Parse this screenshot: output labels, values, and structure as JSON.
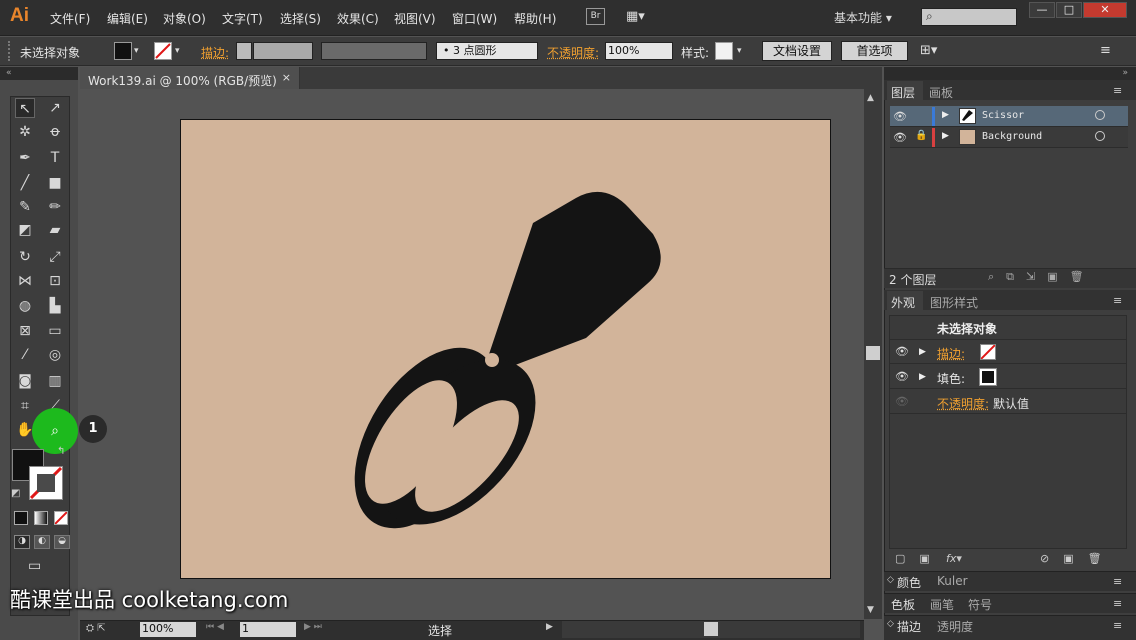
{
  "app": {
    "logo": "Ai"
  },
  "menu": [
    "文件(F)",
    "编辑(E)",
    "对象(O)",
    "文字(T)",
    "选择(S)",
    "效果(C)",
    "视图(V)",
    "窗口(W)",
    "帮助(H)"
  ],
  "bridge_label": "Br",
  "workspace": "基本功能",
  "window_buttons": [
    "—",
    "□",
    "✕"
  ],
  "control": {
    "selection": "未选择对象",
    "stroke_label": "描边:",
    "brush": "3 点圆形",
    "opacity_label": "不透明度:",
    "opacity_value": "100%",
    "style_label": "样式:",
    "doc_setup": "文档设置",
    "preferences": "首选项"
  },
  "document": {
    "tab_title": "Work139.ai @ 100% (RGB/预览)",
    "close": "×"
  },
  "layers": {
    "tabs": [
      "图层",
      "画板"
    ],
    "items": [
      {
        "name": "Scissor"
      },
      {
        "name": "Background"
      }
    ],
    "count": "2 个图层"
  },
  "appearance": {
    "tabs": [
      "外观",
      "图形样式"
    ],
    "title": "未选择对象",
    "stroke_label": "描边:",
    "fill_label": "填色:",
    "opacity_label": "不透明度:",
    "opacity_value": "默认值"
  },
  "bottom_panels": {
    "row1": [
      "颜色",
      "Kuler"
    ],
    "row2": [
      "色板",
      "画笔",
      "符号"
    ],
    "row3": [
      "描边",
      "透明度"
    ]
  },
  "status": {
    "zoom": "100%",
    "artboard": "1",
    "tool": "选择"
  },
  "watermark": "酷课堂出品 coolketang.com",
  "step_badge": "1",
  "colors": {
    "accent": "#e9852b",
    "artboard": "#d2b49a",
    "artwork": "#141414",
    "highlight": "#1dba1d",
    "layer_blue": "#3a7ad8",
    "layer_red": "#d84040"
  }
}
